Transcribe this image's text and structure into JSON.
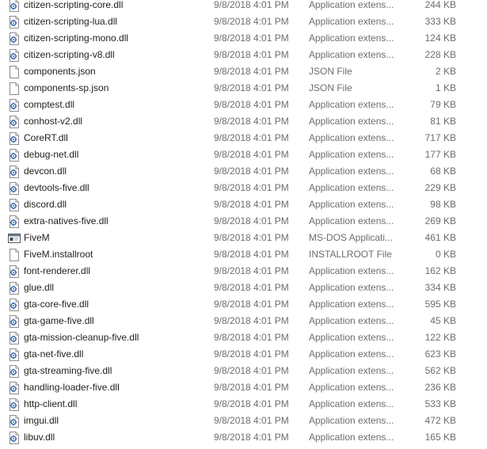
{
  "files": [
    {
      "name": "citizen-scripting-core.dll",
      "date": "9/8/2018 4:01 PM",
      "type": "Application extens...",
      "size": "244 KB",
      "icon": "dll-file-icon"
    },
    {
      "name": "citizen-scripting-lua.dll",
      "date": "9/8/2018 4:01 PM",
      "type": "Application extens...",
      "size": "333 KB",
      "icon": "dll-file-icon"
    },
    {
      "name": "citizen-scripting-mono.dll",
      "date": "9/8/2018 4:01 PM",
      "type": "Application extens...",
      "size": "124 KB",
      "icon": "dll-file-icon"
    },
    {
      "name": "citizen-scripting-v8.dll",
      "date": "9/8/2018 4:01 PM",
      "type": "Application extens...",
      "size": "228 KB",
      "icon": "dll-file-icon"
    },
    {
      "name": "components.json",
      "date": "9/8/2018 4:01 PM",
      "type": "JSON File",
      "size": "2 KB",
      "icon": "blank-file-icon"
    },
    {
      "name": "components-sp.json",
      "date": "9/8/2018 4:01 PM",
      "type": "JSON File",
      "size": "1 KB",
      "icon": "blank-file-icon"
    },
    {
      "name": "comptest.dll",
      "date": "9/8/2018 4:01 PM",
      "type": "Application extens...",
      "size": "79 KB",
      "icon": "dll-file-icon"
    },
    {
      "name": "conhost-v2.dll",
      "date": "9/8/2018 4:01 PM",
      "type": "Application extens...",
      "size": "81 KB",
      "icon": "dll-file-icon"
    },
    {
      "name": "CoreRT.dll",
      "date": "9/8/2018 4:01 PM",
      "type": "Application extens...",
      "size": "717 KB",
      "icon": "dll-file-icon"
    },
    {
      "name": "debug-net.dll",
      "date": "9/8/2018 4:01 PM",
      "type": "Application extens...",
      "size": "177 KB",
      "icon": "dll-file-icon"
    },
    {
      "name": "devcon.dll",
      "date": "9/8/2018 4:01 PM",
      "type": "Application extens...",
      "size": "68 KB",
      "icon": "dll-file-icon"
    },
    {
      "name": "devtools-five.dll",
      "date": "9/8/2018 4:01 PM",
      "type": "Application extens...",
      "size": "229 KB",
      "icon": "dll-file-icon"
    },
    {
      "name": "discord.dll",
      "date": "9/8/2018 4:01 PM",
      "type": "Application extens...",
      "size": "98 KB",
      "icon": "dll-file-icon"
    },
    {
      "name": "extra-natives-five.dll",
      "date": "9/8/2018 4:01 PM",
      "type": "Application extens...",
      "size": "269 KB",
      "icon": "dll-file-icon"
    },
    {
      "name": "FiveM",
      "date": "9/8/2018 4:01 PM",
      "type": "MS-DOS Applicati...",
      "size": "461 KB",
      "icon": "application-icon"
    },
    {
      "name": "FiveM.installroot",
      "date": "9/8/2018 4:01 PM",
      "type": "INSTALLROOT File",
      "size": "0 KB",
      "icon": "blank-file-icon"
    },
    {
      "name": "font-renderer.dll",
      "date": "9/8/2018 4:01 PM",
      "type": "Application extens...",
      "size": "162 KB",
      "icon": "dll-file-icon"
    },
    {
      "name": "glue.dll",
      "date": "9/8/2018 4:01 PM",
      "type": "Application extens...",
      "size": "334 KB",
      "icon": "dll-file-icon"
    },
    {
      "name": "gta-core-five.dll",
      "date": "9/8/2018 4:01 PM",
      "type": "Application extens...",
      "size": "595 KB",
      "icon": "dll-file-icon"
    },
    {
      "name": "gta-game-five.dll",
      "date": "9/8/2018 4:01 PM",
      "type": "Application extens...",
      "size": "45 KB",
      "icon": "dll-file-icon"
    },
    {
      "name": "gta-mission-cleanup-five.dll",
      "date": "9/8/2018 4:01 PM",
      "type": "Application extens...",
      "size": "122 KB",
      "icon": "dll-file-icon"
    },
    {
      "name": "gta-net-five.dll",
      "date": "9/8/2018 4:01 PM",
      "type": "Application extens...",
      "size": "623 KB",
      "icon": "dll-file-icon"
    },
    {
      "name": "gta-streaming-five.dll",
      "date": "9/8/2018 4:01 PM",
      "type": "Application extens...",
      "size": "562 KB",
      "icon": "dll-file-icon"
    },
    {
      "name": "handling-loader-five.dll",
      "date": "9/8/2018 4:01 PM",
      "type": "Application extens...",
      "size": "236 KB",
      "icon": "dll-file-icon"
    },
    {
      "name": "http-client.dll",
      "date": "9/8/2018 4:01 PM",
      "type": "Application extens...",
      "size": "533 KB",
      "icon": "dll-file-icon"
    },
    {
      "name": "imgui.dll",
      "date": "9/8/2018 4:01 PM",
      "type": "Application extens...",
      "size": "472 KB",
      "icon": "dll-file-icon"
    },
    {
      "name": "libuv.dll",
      "date": "9/8/2018 4:01 PM",
      "type": "Application extens...",
      "size": "165 KB",
      "icon": "dll-file-icon"
    }
  ]
}
